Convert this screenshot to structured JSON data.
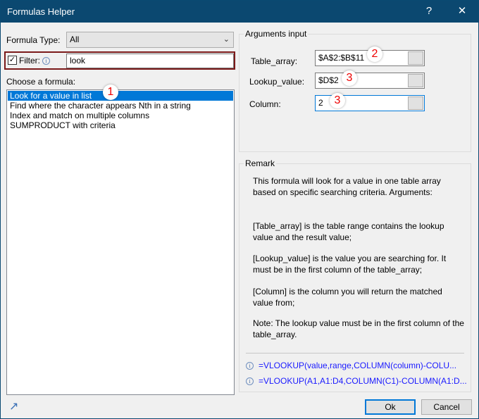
{
  "window": {
    "title": "Formulas Helper",
    "help": "?",
    "close": "✕"
  },
  "formula_type": {
    "label": "Formula Type:",
    "value": "All"
  },
  "filter": {
    "checked": true,
    "label": "Filter:",
    "value": "look"
  },
  "choose": {
    "label": "Choose a formula:",
    "items": [
      "Look for a value in list",
      "Find where the character appears Nth in a string",
      "Index and match on multiple columns",
      "SUMPRODUCT with criteria"
    ],
    "selected": 0
  },
  "arguments": {
    "title": "Arguments input",
    "fields": [
      {
        "label": "Table_array:",
        "value": "$A$2:$B$11",
        "badge": "2"
      },
      {
        "label": "Lookup_value:",
        "value": "$D$2",
        "badge": "3"
      },
      {
        "label": "Column:",
        "value": "2",
        "badge": "3"
      }
    ]
  },
  "list_badge": "1",
  "remark": {
    "title": "Remark",
    "paragraphs": [
      "This formula will look for a value in one table array based on specific searching criteria. Arguments:",
      "[Table_array] is the table range contains the lookup value and the result value;",
      "[Lookup_value] is the value you are searching for. It must be in the first column of the table_array;",
      "[Column] is the column you will return the matched value from;",
      "Note: The lookup value must be in the first column of the table_array."
    ],
    "formulas": [
      "=VLOOKUP(value,range,COLUMN(column)-COLU...",
      "=VLOOKUP(A1,A1:D4,COLUMN(C1)-COLUMN(A1:D..."
    ]
  },
  "buttons": {
    "ok": "Ok",
    "cancel": "Cancel"
  },
  "colors": {
    "titlebar": "#0b4870",
    "selection": "#0078d7",
    "filter_outline": "#7b1a1a",
    "formula_text": "#1a1aff",
    "badge": "#e00000"
  }
}
